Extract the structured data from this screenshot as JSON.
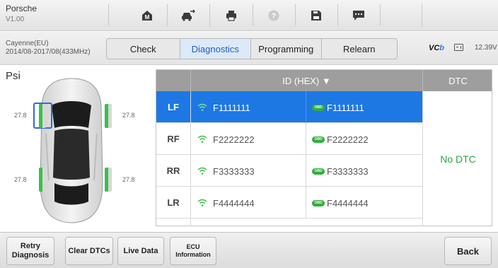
{
  "app": {
    "title": "Porsche",
    "version": "V1.00"
  },
  "toolbar": {
    "icons": [
      "home-icon",
      "vehicle-swap-icon",
      "print-icon",
      "help-icon",
      "save-icon",
      "message-icon"
    ]
  },
  "vehicle": {
    "model": "Cayenne(EU)",
    "dates": "2014/08-2017/08(433MHz)"
  },
  "tabs": [
    {
      "label": "Check",
      "active": false
    },
    {
      "label": "Diagnostics",
      "active": true
    },
    {
      "label": "Programming",
      "active": false
    },
    {
      "label": "Relearn",
      "active": false
    }
  ],
  "status": {
    "vci_label": "VC",
    "vci_accent": "b",
    "voltage": "12.39V"
  },
  "tpms": {
    "unit": "Psi",
    "tyres": {
      "lf": "27.8",
      "rf": "27.8",
      "lr": "27.8",
      "rr": "27.8"
    }
  },
  "table": {
    "header_id": "ID (HEX) ▼",
    "header_dtc": "DTC",
    "dtc_value": "No DTC",
    "rows": [
      {
        "pos": "LF",
        "sensor_id": "F1111111",
        "obd_id": "F1111111",
        "selected": true
      },
      {
        "pos": "RF",
        "sensor_id": "F2222222",
        "obd_id": "F2222222",
        "selected": false
      },
      {
        "pos": "RR",
        "sensor_id": "F3333333",
        "obd_id": "F3333333",
        "selected": false
      },
      {
        "pos": "LR",
        "sensor_id": "F4444444",
        "obd_id": "F4444444",
        "selected": false
      }
    ]
  },
  "footer": {
    "retry": "Retry\nDiagnosis",
    "clear_dtcs": "Clear DTCs",
    "live_data": "Live Data",
    "ecu_info": "ECU\nInformation",
    "back": "Back"
  },
  "colors": {
    "accent_blue": "#1e78e4",
    "ok_green": "#2aa935",
    "sensor_green": "#3ac04a"
  }
}
